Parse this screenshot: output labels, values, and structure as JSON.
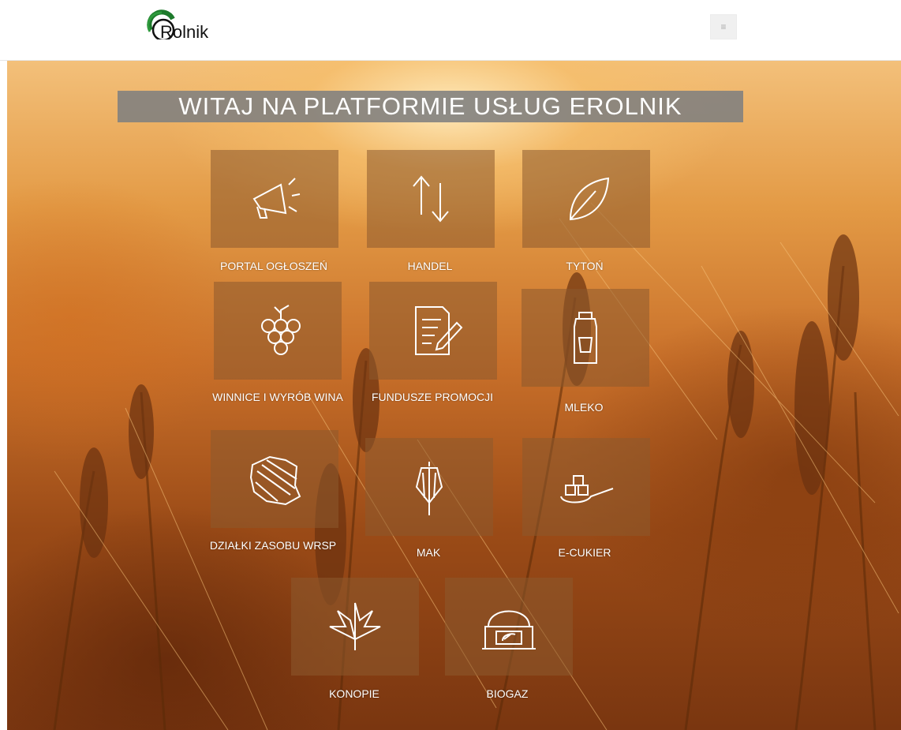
{
  "header": {
    "logo_text": "Rolnik",
    "menu_icon": "hamburger-icon",
    "menu_glyph": "≡"
  },
  "hero": {
    "title": "WITAJ NA PLATFORMIE USŁUG EROLNIK"
  },
  "tiles": [
    {
      "label": "PORTAL OGŁOSZEŃ",
      "icon": "megaphone-icon"
    },
    {
      "label": "HANDEL",
      "icon": "arrows-up-down-icon"
    },
    {
      "label": "TYTOŃ",
      "icon": "leaf-icon"
    },
    {
      "label": "WINNICE I WYRÓB WINA",
      "icon": "grapes-icon"
    },
    {
      "label": "FUNDUSZE PROMOCJI",
      "icon": "document-pen-icon"
    },
    {
      "label": "MLEKO",
      "icon": "milk-can-icon"
    },
    {
      "label": "DZIAŁKI ZASOBU WRSP",
      "icon": "poland-map-icon"
    },
    {
      "label": "MAK",
      "icon": "poppy-icon"
    },
    {
      "label": "E-CUKIER",
      "icon": "sugar-spoon-icon"
    },
    {
      "label": "KONOPIE",
      "icon": "hemp-leaf-icon"
    },
    {
      "label": "BIOGAZ",
      "icon": "biogas-plant-icon"
    }
  ]
}
